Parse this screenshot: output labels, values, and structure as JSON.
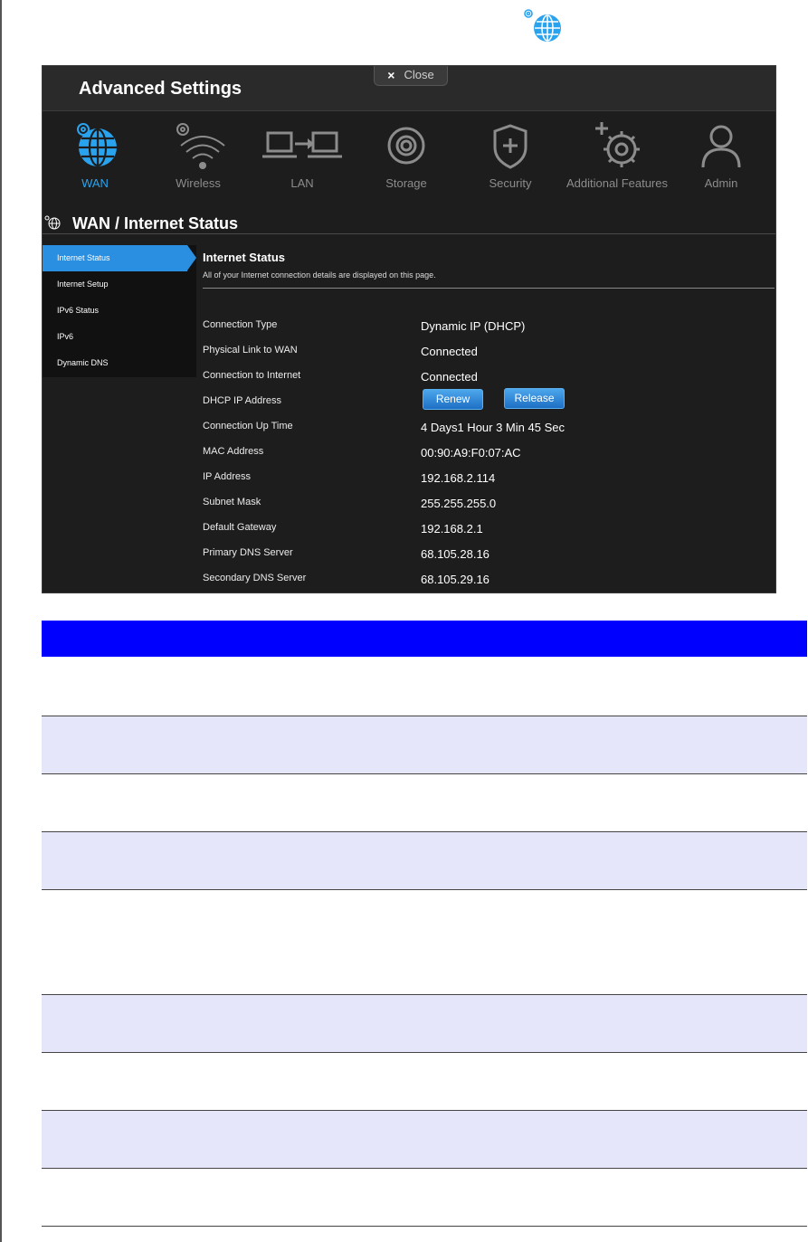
{
  "panel": {
    "title": "Advanced Settings",
    "close_label": "Close",
    "close_glyph": "×"
  },
  "nav": {
    "items": [
      {
        "label": "WAN",
        "icon": "globe-gear-icon",
        "active": true
      },
      {
        "label": "Wireless",
        "icon": "wifi-gear-icon"
      },
      {
        "label": "LAN",
        "icon": "lan-icon"
      },
      {
        "label": "Storage",
        "icon": "disc-icon"
      },
      {
        "label": "Security",
        "icon": "shield-plus-icon"
      },
      {
        "label": "Additional Features",
        "icon": "gear-plus-icon"
      },
      {
        "label": "Admin",
        "icon": "person-icon"
      }
    ]
  },
  "section": {
    "title": "WAN / Internet Status"
  },
  "sidebar": {
    "items": [
      {
        "label": "Internet Status",
        "active": true
      },
      {
        "label": "Internet Setup"
      },
      {
        "label": "IPv6 Status"
      },
      {
        "label": "IPv6"
      },
      {
        "label": "Dynamic DNS"
      }
    ]
  },
  "content": {
    "title": "Internet Status",
    "description": "All of your Internet connection details are displayed on this page.",
    "rows": [
      {
        "label": "Connection Type",
        "value": "Dynamic IP (DHCP)"
      },
      {
        "label": "Physical Link to WAN",
        "value": "Connected"
      },
      {
        "label": "Connection to Internet",
        "value": "Connected"
      },
      {
        "label": "DHCP IP Address",
        "value": ""
      },
      {
        "label": "Connection Up Time",
        "value": "4 Days1 Hour 3 Min 45 Sec"
      },
      {
        "label": "MAC Address",
        "value": "00:90:A9:F0:07:AC"
      },
      {
        "label": "IP Address",
        "value": "192.168.2.114"
      },
      {
        "label": "Subnet Mask",
        "value": "255.255.255.0"
      },
      {
        "label": "Default Gateway",
        "value": "192.168.2.1"
      },
      {
        "label": "Primary DNS Server",
        "value": "68.105.28.16"
      },
      {
        "label": "Secondary DNS Server",
        "value": "68.105.29.16"
      }
    ],
    "renew_label": "Renew",
    "release_label": "Release"
  },
  "colors": {
    "accent": "#2aa3ee",
    "panel_bg": "#1d1d1d",
    "table_header": "#0000ff",
    "table_shade": "#e6e6fa"
  }
}
